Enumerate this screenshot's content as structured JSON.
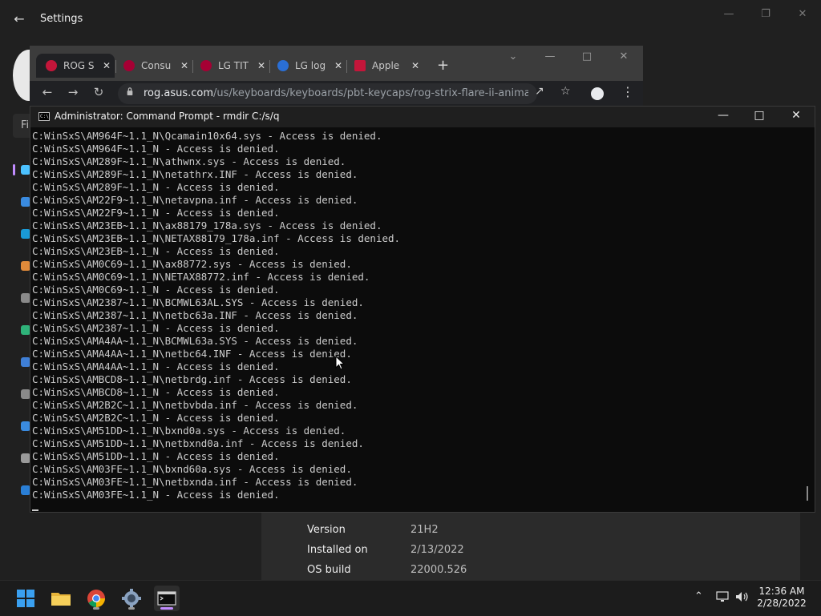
{
  "settings": {
    "title": "Settings",
    "find_prefix": "Fi",
    "about": [
      {
        "label": "Version",
        "value": "21H2"
      },
      {
        "label": "Installed on",
        "value": "2/13/2022"
      },
      {
        "label": "OS build",
        "value": "22000.526"
      }
    ]
  },
  "chrome": {
    "tabs": [
      {
        "label": "ROG S",
        "favicon_color": "#c4163a"
      },
      {
        "label": "Consu",
        "favicon_color": "#a50034"
      },
      {
        "label": "LG TIT",
        "favicon_color": "#a50034"
      },
      {
        "label": "LG log",
        "favicon_color": "#2a6fd6"
      },
      {
        "label": "Apple",
        "favicon_color": "#c4163a"
      }
    ],
    "url_host": "rog.asus.com",
    "url_path": "/us/keyboards/keyboards/pbt-keycaps/rog-strix-flare-ii-anima..."
  },
  "cmd": {
    "title": "Administrator: Command Prompt - rmdir  C:/s/q",
    "lines": [
      "C:WinSxS\\AM964F~1.1_N\\Qcamain10x64.sys - Access is denied.",
      "C:WinSxS\\AM964F~1.1_N - Access is denied.",
      "C:WinSxS\\AM289F~1.1_N\\athwnx.sys - Access is denied.",
      "C:WinSxS\\AM289F~1.1_N\\netathrx.INF - Access is denied.",
      "C:WinSxS\\AM289F~1.1_N - Access is denied.",
      "C:WinSxS\\AM22F9~1.1_N\\netavpna.inf - Access is denied.",
      "C:WinSxS\\AM22F9~1.1_N - Access is denied.",
      "C:WinSxS\\AM23EB~1.1_N\\ax88179_178a.sys - Access is denied.",
      "C:WinSxS\\AM23EB~1.1_N\\NETAX88179_178a.inf - Access is denied.",
      "C:WinSxS\\AM23EB~1.1_N - Access is denied.",
      "C:WinSxS\\AM0C69~1.1_N\\ax88772.sys - Access is denied.",
      "C:WinSxS\\AM0C69~1.1_N\\NETAX88772.inf - Access is denied.",
      "C:WinSxS\\AM0C69~1.1_N - Access is denied.",
      "C:WinSxS\\AM2387~1.1_N\\BCMWL63AL.SYS - Access is denied.",
      "C:WinSxS\\AM2387~1.1_N\\netbc63a.INF - Access is denied.",
      "C:WinSxS\\AM2387~1.1_N - Access is denied.",
      "C:WinSxS\\AMA4AA~1.1_N\\BCMWL63a.SYS - Access is denied.",
      "C:WinSxS\\AMA4AA~1.1_N\\netbc64.INF - Access is denied.",
      "C:WinSxS\\AMA4AA~1.1_N - Access is denied.",
      "C:WinSxS\\AMBCD8~1.1_N\\netbrdg.inf - Access is denied.",
      "C:WinSxS\\AMBCD8~1.1_N - Access is denied.",
      "C:WinSxS\\AM2B2C~1.1_N\\netbvbda.inf - Access is denied.",
      "C:WinSxS\\AM2B2C~1.1_N - Access is denied.",
      "C:WinSxS\\AM51DD~1.1_N\\bxnd0a.sys - Access is denied.",
      "C:WinSxS\\AM51DD~1.1_N\\netbxnd0a.inf - Access is denied.",
      "C:WinSxS\\AM51DD~1.1_N - Access is denied.",
      "C:WinSxS\\AM03FE~1.1_N\\bxnd60a.sys - Access is denied.",
      "C:WinSxS\\AM03FE~1.1_N\\netbxnda.inf - Access is denied.",
      "C:WinSxS\\AM03FE~1.1_N - Access is denied."
    ]
  },
  "taskbar": {
    "apps": [
      "start-icon",
      "file-explorer-icon",
      "chrome-icon",
      "settings-icon",
      "terminal-icon"
    ],
    "time": "12:36 AM",
    "date": "2/28/2022"
  },
  "colors": {
    "accent": "#c18cff",
    "cmd_bg": "#0c0c0c",
    "cmd_text": "#cccccc"
  }
}
